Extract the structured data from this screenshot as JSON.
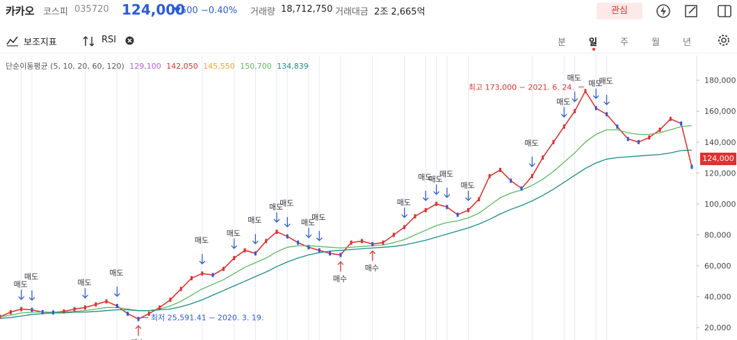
{
  "header": {
    "stock_name": "카카오",
    "market": "코스피",
    "code": "035720",
    "price": "124,000",
    "change": "▼500  −0.40%",
    "volume_label": "거래량",
    "volume_value": "18,712,750",
    "amount_label": "거래대금",
    "amount_value": "2조 2,665억",
    "watch_label": "관심"
  },
  "toolbar": {
    "indicator_label": "보조지표",
    "rsi_label": "RSI",
    "periods": [
      "분",
      "일",
      "주",
      "월",
      "년"
    ],
    "active_period": "일"
  },
  "ma": {
    "label": "단순이동평균 (5, 10, 20, 60, 120)",
    "values": [
      {
        "value": "129,100",
        "color": "#b15de0"
      },
      {
        "value": "142,050",
        "color": "#e03131"
      },
      {
        "value": "145,550",
        "color": "#f0a22b"
      },
      {
        "value": "150,700",
        "color": "#5cb85c"
      },
      {
        "value": "134,839",
        "color": "#1a8a8a"
      }
    ]
  },
  "colors": {
    "up": "#e03131",
    "down": "#2a5bd7",
    "accent": "#2a5bd7"
  },
  "price_tag": "124,000",
  "chart_data": {
    "type": "line",
    "y_ticks": [
      "180,000",
      "160,000",
      "140,000",
      "120,000",
      "100,000",
      "80,000",
      "60,000",
      "40,000",
      "20,000"
    ],
    "ylim": [
      12000,
      196000
    ],
    "series": [
      {
        "name": "price",
        "y": [
          27000,
          30000,
          32000,
          31500,
          30000,
          29800,
          30500,
          32000,
          33000,
          35000,
          37000,
          34000,
          29000,
          25591,
          29000,
          33000,
          38000,
          45000,
          52000,
          55000,
          54000,
          58000,
          65000,
          70000,
          68000,
          76000,
          82000,
          79000,
          75000,
          72000,
          70000,
          68000,
          67000,
          75000,
          76000,
          74000,
          75000,
          80000,
          85000,
          92000,
          96000,
          100000,
          98000,
          93000,
          96000,
          103000,
          118000,
          122000,
          115000,
          110000,
          118000,
          130000,
          140000,
          150000,
          160000,
          173000,
          162000,
          158000,
          150000,
          142000,
          140000,
          143000,
          148000,
          155000,
          152000,
          124000
        ]
      },
      {
        "name": "ma60",
        "y": [
          27000,
          28000,
          29500,
          30000,
          30000,
          30000,
          30000,
          30500,
          31000,
          32000,
          33000,
          33000,
          32000,
          31000,
          31000,
          32000,
          34000,
          37000,
          41000,
          45000,
          48000,
          51000,
          55000,
          59000,
          62000,
          65000,
          69000,
          72000,
          73000,
          73000,
          72500,
          72000,
          71500,
          72000,
          72500,
          73000,
          73500,
          75000,
          77000,
          80000,
          83000,
          86000,
          88000,
          89000,
          91000,
          94000,
          99000,
          104000,
          107000,
          109000,
          112000,
          116000,
          121000,
          127000,
          133000,
          140000,
          145000,
          148000,
          148000,
          146000,
          145000,
          145000,
          146000,
          148000,
          150000,
          150700
        ]
      },
      {
        "name": "ma120",
        "y": [
          26000,
          26500,
          27500,
          28500,
          29000,
          29500,
          29500,
          30000,
          30000,
          30500,
          31000,
          31500,
          31500,
          31000,
          31000,
          31500,
          32000,
          33500,
          35500,
          38000,
          41000,
          44000,
          47000,
          50000,
          53000,
          56000,
          59500,
          62500,
          65000,
          67000,
          68500,
          69500,
          70000,
          70500,
          71000,
          71500,
          72000,
          72500,
          73500,
          75000,
          76500,
          78500,
          80500,
          82500,
          84500,
          87000,
          90000,
          93500,
          96500,
          99000,
          102000,
          105500,
          109500,
          114000,
          118500,
          123000,
          126500,
          129000,
          130000,
          130500,
          131000,
          131500,
          132000,
          133000,
          134500,
          134839
        ]
      }
    ],
    "annotations": [
      {
        "text": "최고 173,000 − 2021. 6. 24.",
        "index": 55,
        "value": 173000,
        "color": "#e03131"
      },
      {
        "text": "최저 25,591.41 − 2020. 3. 19.",
        "index": 13,
        "value": 25591,
        "color": "#2a5bd7"
      }
    ],
    "signals": [
      {
        "label": "매도",
        "index": 2,
        "type": "sell"
      },
      {
        "label": "매도",
        "index": 3,
        "type": "sell"
      },
      {
        "label": "매도",
        "index": 8,
        "type": "sell"
      },
      {
        "label": "매도",
        "index": 11,
        "type": "sell"
      },
      {
        "label": "매수",
        "index": 13,
        "type": "buy"
      },
      {
        "label": "매도",
        "index": 19,
        "type": "sell"
      },
      {
        "label": "매도",
        "index": 22,
        "type": "sell"
      },
      {
        "label": "매도",
        "index": 24,
        "type": "sell"
      },
      {
        "label": "매도",
        "index": 26,
        "type": "sell"
      },
      {
        "label": "매도",
        "index": 27,
        "type": "sell"
      },
      {
        "label": "매도",
        "index": 29,
        "type": "sell"
      },
      {
        "label": "매도",
        "index": 30,
        "type": "sell"
      },
      {
        "label": "매수",
        "index": 32,
        "type": "buy"
      },
      {
        "label": "매수",
        "index": 35,
        "type": "buy"
      },
      {
        "label": "매도",
        "index": 38,
        "type": "sell"
      },
      {
        "label": "매도",
        "index": 40,
        "type": "sell"
      },
      {
        "label": "매도",
        "index": 41,
        "type": "sell"
      },
      {
        "label": "매도",
        "index": 42,
        "type": "sell"
      },
      {
        "label": "매도",
        "index": 44,
        "type": "sell"
      },
      {
        "label": "매도",
        "index": 50,
        "type": "sell"
      },
      {
        "label": "매도",
        "index": 53,
        "type": "sell"
      },
      {
        "label": "매도",
        "index": 54,
        "type": "sell"
      },
      {
        "label": "매도",
        "index": 56,
        "type": "sell"
      },
      {
        "label": "매도",
        "index": 57,
        "type": "sell"
      }
    ]
  }
}
